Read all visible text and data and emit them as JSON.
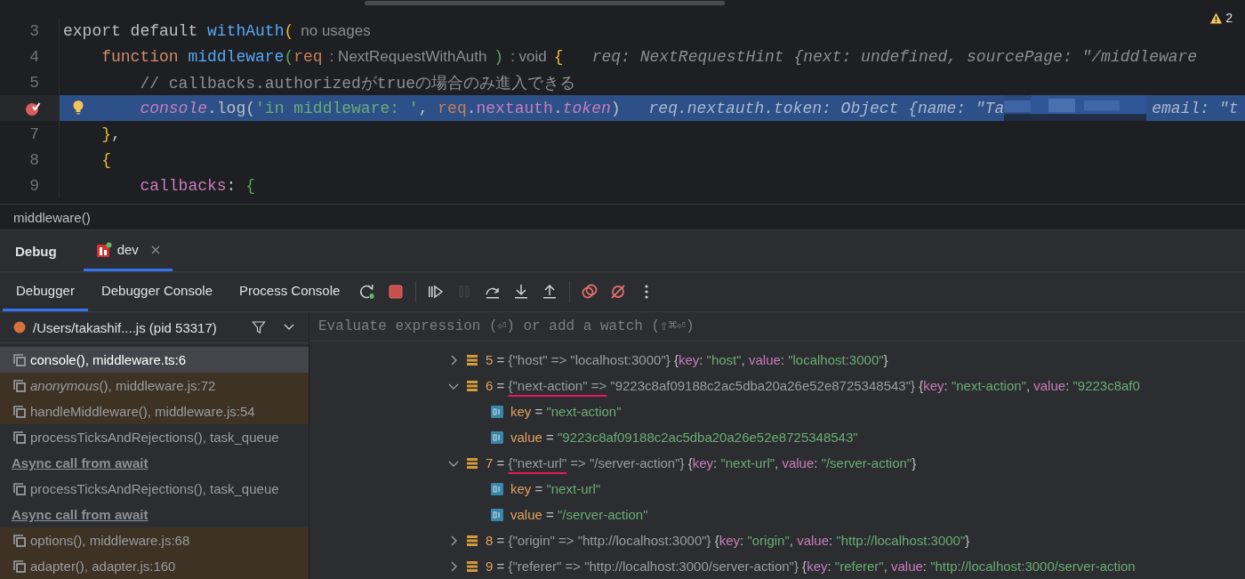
{
  "editor": {
    "warning_count": "2",
    "lines": [
      {
        "number": "3",
        "breakpoint": false,
        "current": false,
        "bulb": false,
        "segments": [
          {
            "kind": "code",
            "tokens": [
              {
                "kind": "plain",
                "t": "export default "
              },
              {
                "kind": "fn",
                "t": "withAuth"
              },
              {
                "kind": "brace",
                "t": "("
              }
            ]
          },
          {
            "kind": "inlay",
            "text": "no usages"
          }
        ],
        "children": [
          {
            "number": "4",
            "breakpoint": false,
            "current": false,
            "bulb": false,
            "segments": [
              {
                "kind": "code",
                "tokens": [
                  {
                    "kind": "kw",
                    "t": "function "
                  },
                  {
                    "kind": "fn",
                    "t": "middleware"
                  },
                  {
                    "kind": "paren",
                    "t": "("
                  },
                  {
                    "kind": "param",
                    "t": "req"
                  }
                ]
              },
              {
                "kind": "inlay",
                "text": ": NextRequestWithAuth"
              },
              {
                "kind": "code",
                "tokens": [
                  {
                    "kind": "paren",
                    "t": ")"
                  }
                ]
              },
              {
                "kind": "inlay",
                "text": ": void"
              },
              {
                "kind": "code",
                "tokens": [
                  {
                    "kind": "brace",
                    "t": "{"
                  }
                ]
              },
              {
                "kind": "hint",
                "text": "req: NextRequestHint {next: undefined, sourcePage: \"/middleware"
              }
            ],
            "children": [
              {
                "number": "5",
                "breakpoint": false,
                "current": false,
                "bulb": false,
                "segments": [
                  {
                    "kind": "code",
                    "tokens": [
                      {
                        "kind": "comment",
                        "t": "// callbacks.authorizedがtrueの場合のみ進入できる"
                      }
                    ]
                  }
                ]
              },
              {
                "breakpoint": true,
                "current": true,
                "bulb": true,
                "segments": [
                  {
                    "kind": "code",
                    "tokens": [
                      {
                        "kind": "propi",
                        "t": "console"
                      },
                      {
                        "kind": "plain",
                        "t": ".log("
                      },
                      {
                        "kind": "str",
                        "t": "'in middleware: '"
                      },
                      {
                        "kind": "plain",
                        "t": ", "
                      },
                      {
                        "kind": "param",
                        "t": "req"
                      },
                      {
                        "kind": "plain",
                        "t": "."
                      },
                      {
                        "kind": "prop",
                        "t": "nextauth"
                      },
                      {
                        "kind": "plain",
                        "t": "."
                      },
                      {
                        "kind": "propi",
                        "t": "token"
                      },
                      {
                        "kind": "plain",
                        "t": ")"
                      }
                    ]
                  },
                  {
                    "kind": "hint",
                    "text": "req.nextauth.token: Object {name: \"Ta"
                  },
                  {
                    "kind": "redacted"
                  },
                  {
                    "kind": "hint",
                    "text": "email: \"t"
                  }
                ]
              }
            ]
          },
          {
            "number": "7",
            "breakpoint": false,
            "current": false,
            "bulb": false,
            "segments": [
              {
                "kind": "code",
                "tokens": [
                  {
                    "kind": "brace",
                    "t": "}"
                  },
                  {
                    "kind": "plain",
                    "t": ","
                  }
                ]
              }
            ]
          },
          {
            "number": "8",
            "breakpoint": false,
            "current": false,
            "bulb": false,
            "segments": [
              {
                "kind": "code",
                "tokens": [
                  {
                    "kind": "brace",
                    "t": "{"
                  }
                ]
              }
            ],
            "children": [
              {
                "number": "9",
                "breakpoint": false,
                "current": false,
                "bulb": false,
                "segments": [
                  {
                    "kind": "code",
                    "tokens": [
                      {
                        "kind": "prop",
                        "t": "callbacks"
                      },
                      {
                        "kind": "plain",
                        "t": ": "
                      },
                      {
                        "kind": "paren",
                        "t": "{"
                      }
                    ]
                  }
                ]
              }
            ]
          }
        ]
      }
    ]
  },
  "breadcrumb": "middleware()",
  "debug_panel": {
    "title": "Debug",
    "session": "dev",
    "tabs": [
      {
        "label": "Debugger",
        "selected": true
      },
      {
        "label": "Debugger Console",
        "selected": false
      },
      {
        "label": "Process Console",
        "selected": false
      }
    ],
    "toolbar": [
      {
        "kind": "rerun",
        "disabled": false
      },
      {
        "kind": "stop",
        "disabled": false
      },
      {
        "kind": "separator"
      },
      {
        "kind": "resume",
        "disabled": false
      },
      {
        "kind": "pause",
        "disabled": true
      },
      {
        "kind": "step-over",
        "disabled": false
      },
      {
        "kind": "step-into",
        "disabled": false
      },
      {
        "kind": "step-out",
        "disabled": false
      },
      {
        "kind": "separator"
      },
      {
        "kind": "breakpoints",
        "disabled": false
      },
      {
        "kind": "mute",
        "disabled": false
      },
      {
        "kind": "more",
        "disabled": false
      }
    ]
  },
  "process": {
    "label": "/Users/takashif....js (pid 53317)"
  },
  "evaluate": {
    "placeholder": "Evaluate expression (⏎) or add a watch (⇧⌘⏎)"
  },
  "frames": [
    {
      "kind": "frame",
      "text": "console(), middleware.ts:6",
      "selected": true,
      "library": false
    },
    {
      "kind": "frame",
      "text": "*anonymous*(), middleware.js:72",
      "selected": false,
      "library": true
    },
    {
      "kind": "frame",
      "text": "handleMiddleware(), middleware.js:54",
      "selected": false,
      "library": true
    },
    {
      "kind": "frame",
      "text": "processTicksAndRejections(), task_queue",
      "selected": false,
      "library": false
    },
    {
      "kind": "async",
      "text": "Async call from await"
    },
    {
      "kind": "frame",
      "text": "processTicksAndRejections(), task_queue",
      "selected": false,
      "library": false
    },
    {
      "kind": "async",
      "text": "Async call from await"
    },
    {
      "kind": "frame",
      "text": "options(), middleware.js:68",
      "selected": false,
      "library": true
    },
    {
      "kind": "frame",
      "text": "adapter(), adapter.js:160",
      "selected": false,
      "library": true
    }
  ],
  "variables": [
    {
      "expanded": false,
      "tokens": [
        {
          "kind": "num",
          "t": "5"
        },
        {
          "kind": "plain",
          "t": " = "
        },
        {
          "kind": "grey",
          "t": "{\"host\" => \"localhost:3000\"}"
        },
        {
          "kind": "plain",
          "t": " {"
        },
        {
          "kind": "prop",
          "t": "key"
        },
        {
          "kind": "plain",
          "t": ": "
        },
        {
          "kind": "str",
          "t": "\"host\""
        },
        {
          "kind": "plain",
          "t": ", "
        },
        {
          "kind": "prop",
          "t": "value"
        },
        {
          "kind": "plain",
          "t": ": "
        },
        {
          "kind": "str",
          "t": "\"localhost:3000\""
        },
        {
          "kind": "plain",
          "t": "}"
        }
      ]
    },
    {
      "expanded": true,
      "tokens": [
        {
          "kind": "num",
          "t": "6"
        },
        {
          "kind": "plain",
          "t": " = "
        },
        {
          "kind": "grey",
          "t": "{\"next-action\" =>",
          "marked": true
        },
        {
          "kind": "grey",
          "t": " \"9223c8af09188c2ac5dba20a26e52e8725348543\"}"
        },
        {
          "kind": "plain",
          "t": " {"
        },
        {
          "kind": "prop",
          "t": "key"
        },
        {
          "kind": "plain",
          "t": ": "
        },
        {
          "kind": "str",
          "t": "\"next-action\""
        },
        {
          "kind": "plain",
          "t": ", "
        },
        {
          "kind": "prop",
          "t": "value"
        },
        {
          "kind": "plain",
          "t": ": "
        },
        {
          "kind": "str",
          "t": "\"9223c8af0"
        }
      ],
      "children": [
        {
          "tokens": [
            {
              "kind": "key",
              "t": "key"
            },
            {
              "kind": "plain",
              "t": " = "
            },
            {
              "kind": "str",
              "t": "\"next-action\""
            }
          ]
        },
        {
          "tokens": [
            {
              "kind": "key",
              "t": "value"
            },
            {
              "kind": "plain",
              "t": " = "
            },
            {
              "kind": "str",
              "t": "\"9223c8af09188c2ac5dba20a26e52e8725348543\""
            }
          ]
        }
      ]
    },
    {
      "expanded": true,
      "tokens": [
        {
          "kind": "num",
          "t": "7"
        },
        {
          "kind": "plain",
          "t": " = "
        },
        {
          "kind": "grey",
          "t": "{\"next-url\"",
          "marked": true
        },
        {
          "kind": "grey",
          "t": " => \"/server-action\"}"
        },
        {
          "kind": "plain",
          "t": " {"
        },
        {
          "kind": "prop",
          "t": "key"
        },
        {
          "kind": "plain",
          "t": ": "
        },
        {
          "kind": "str",
          "t": "\"next-url\""
        },
        {
          "kind": "plain",
          "t": ", "
        },
        {
          "kind": "prop",
          "t": "value"
        },
        {
          "kind": "plain",
          "t": ": "
        },
        {
          "kind": "str",
          "t": "\"/server-action\""
        },
        {
          "kind": "plain",
          "t": "}"
        }
      ],
      "children": [
        {
          "tokens": [
            {
              "kind": "key",
              "t": "key"
            },
            {
              "kind": "plain",
              "t": " = "
            },
            {
              "kind": "str",
              "t": "\"next-url\""
            }
          ]
        },
        {
          "tokens": [
            {
              "kind": "key",
              "t": "value"
            },
            {
              "kind": "plain",
              "t": " = "
            },
            {
              "kind": "str",
              "t": "\"/server-action\""
            }
          ]
        }
      ]
    },
    {
      "expanded": false,
      "tokens": [
        {
          "kind": "num",
          "t": "8"
        },
        {
          "kind": "plain",
          "t": " = "
        },
        {
          "kind": "grey",
          "t": "{\"origin\" => \"http://localhost:3000\"}"
        },
        {
          "kind": "plain",
          "t": " {"
        },
        {
          "kind": "prop",
          "t": "key"
        },
        {
          "kind": "plain",
          "t": ": "
        },
        {
          "kind": "str",
          "t": "\"origin\""
        },
        {
          "kind": "plain",
          "t": ", "
        },
        {
          "kind": "prop",
          "t": "value"
        },
        {
          "kind": "plain",
          "t": ": "
        },
        {
          "kind": "str",
          "t": "\"http://localhost:3000\""
        },
        {
          "kind": "plain",
          "t": "}"
        }
      ]
    },
    {
      "expanded": false,
      "tokens": [
        {
          "kind": "num",
          "t": "9"
        },
        {
          "kind": "plain",
          "t": " = "
        },
        {
          "kind": "grey",
          "t": "{\"referer\" => \"http://localhost:3000/server-action\"}"
        },
        {
          "kind": "plain",
          "t": " {"
        },
        {
          "kind": "prop",
          "t": "key"
        },
        {
          "kind": "plain",
          "t": ": "
        },
        {
          "kind": "str",
          "t": "\"referer\""
        },
        {
          "kind": "plain",
          "t": ", "
        },
        {
          "kind": "prop",
          "t": "value"
        },
        {
          "kind": "plain",
          "t": ": "
        },
        {
          "kind": "str",
          "t": "\"http://localhost:3000/server-action"
        }
      ]
    }
  ]
}
